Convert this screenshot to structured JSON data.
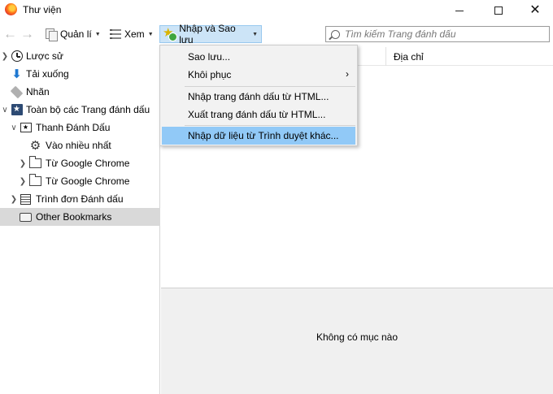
{
  "window": {
    "title": "Thư viện",
    "close_glyph": "✕"
  },
  "toolbar": {
    "back_icon": "arrow-left-icon",
    "forward_icon": "arrow-right-icon",
    "organize_label": "Quản lí",
    "views_label": "Xem",
    "import_label": "Nhập và Sao lưu",
    "search_placeholder": "Tìm kiếm Trang đánh dấu"
  },
  "sidebar": {
    "items": [
      {
        "label": "Lược sử",
        "icon": "clock-icon"
      },
      {
        "label": "Tải xuống",
        "icon": "download-arrow-icon"
      },
      {
        "label": "Nhãn",
        "icon": "tag-icon"
      },
      {
        "label": "Toàn bộ các Trang đánh dấu",
        "icon": "star-box-icon"
      },
      {
        "label": "Thanh Đánh Dấu",
        "icon": "bookmarks-toolbar-icon"
      },
      {
        "label": "Vào nhiều nhất",
        "icon": "gear-icon"
      },
      {
        "label": "Từ Google Chrome",
        "icon": "folder-icon"
      },
      {
        "label": "Từ Google Chrome",
        "icon": "folder-icon"
      },
      {
        "label": "Trình đơn Đánh dấu",
        "icon": "menu-list-icon"
      },
      {
        "label": "Other Bookmarks",
        "icon": "tray-icon"
      }
    ],
    "selected": "Other Bookmarks"
  },
  "content": {
    "column_address": "Địa chỉ",
    "empty_message": "Không có mục nào"
  },
  "menu": {
    "items": [
      {
        "label": "Sao lưu..."
      },
      {
        "label": "Khôi phục",
        "submenu": true
      },
      {
        "label": "Nhập trang đánh dấu từ HTML..."
      },
      {
        "label": "Xuất trang đánh dấu từ HTML..."
      },
      {
        "label": "Nhập dữ liệu từ Trình duyệt khác...",
        "highlighted": true
      }
    ]
  },
  "colors": {
    "menu_highlight": "#91c9f7",
    "button_active": "#cce4f7",
    "selected_row": "#d9d9d9"
  }
}
